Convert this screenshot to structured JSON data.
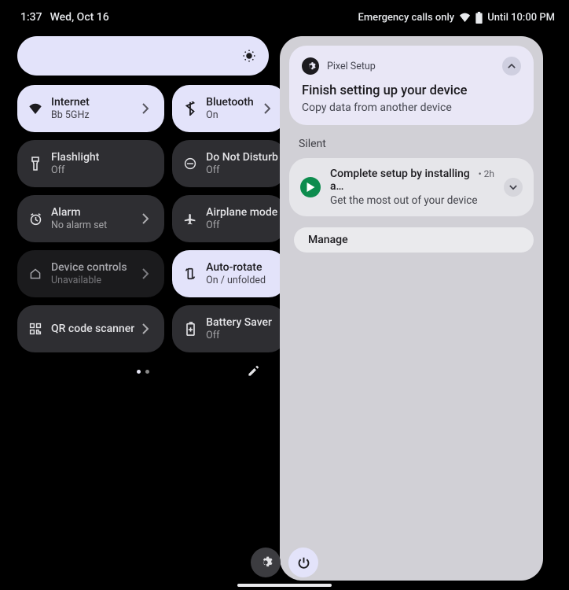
{
  "status": {
    "time": "1:37",
    "date": "Wed, Oct 16",
    "emergency": "Emergency calls only",
    "until": "Until 10:00 PM"
  },
  "tiles": {
    "internet": {
      "title": "Internet",
      "sub": "Bb 5GHz"
    },
    "bluetooth": {
      "title": "Bluetooth",
      "sub": "On"
    },
    "flashlight": {
      "title": "Flashlight",
      "sub": "Off"
    },
    "dnd": {
      "title": "Do Not Disturb",
      "sub": "Off"
    },
    "alarm": {
      "title": "Alarm",
      "sub": "No alarm set"
    },
    "airplane": {
      "title": "Airplane mode",
      "sub": "Off"
    },
    "controls": {
      "title": "Device controls",
      "sub": "Unavailable"
    },
    "autorotate": {
      "title": "Auto-rotate",
      "sub": "On / unfolded"
    },
    "qr": {
      "title": "QR code scanner",
      "sub": ""
    },
    "battery": {
      "title": "Battery Saver",
      "sub": "Off"
    }
  },
  "notif": {
    "setup": {
      "app": "Pixel Setup",
      "title": "Finish setting up your device",
      "body": "Copy data from another device"
    },
    "silentLabel": "Silent",
    "play": {
      "title": "Complete setup by installing a…",
      "meta": "2h",
      "body": "Get the most out of your device"
    },
    "manage": "Manage"
  }
}
